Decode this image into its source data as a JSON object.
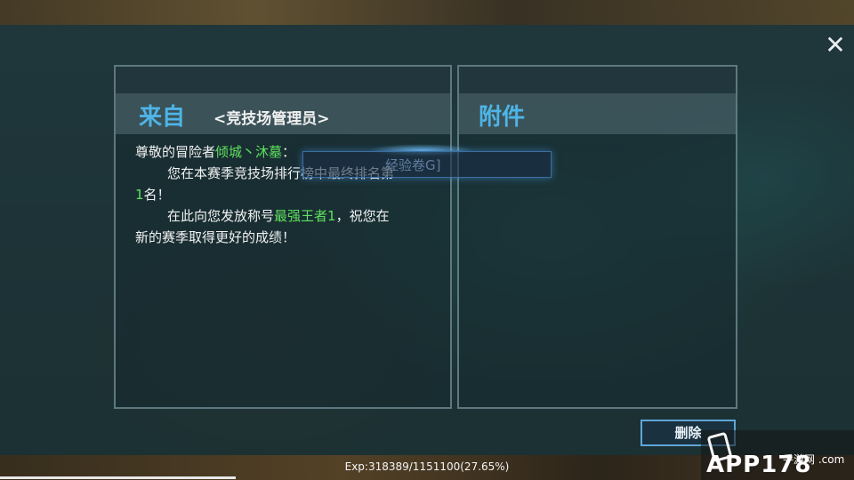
{
  "dialog": {
    "close_icon": "close-icon",
    "from_label": "来自",
    "sender": "<竞技场管理员>",
    "attachment_label": "附件",
    "delete_label": "删除"
  },
  "message": {
    "line1_prefix": "尊敬的冒险者",
    "player_name": "倾城丶沐墓",
    "line1_suffix": "：",
    "line2": "您在本赛季竞技场排行榜中最终排名第",
    "rank": "1",
    "line3_suffix": "名！",
    "line4_prefix": "在此向您发放称号",
    "title_award": "最强王者1",
    "line4_suffix": "，祝您在",
    "line5": "新的赛季取得更好的成绩！"
  },
  "tooltip": {
    "text": "经验卷G]"
  },
  "status": {
    "exp_text": "Exp:318389/1151100(27.65%)",
    "exp_fraction": 0.2765
  },
  "watermark": {
    "brand": "APP178",
    "sub": "手游网\n.com"
  },
  "colors": {
    "header_blue": "#4fb4e6",
    "highlight_green": "#5ee05e",
    "panel_border": "#5e7880"
  }
}
